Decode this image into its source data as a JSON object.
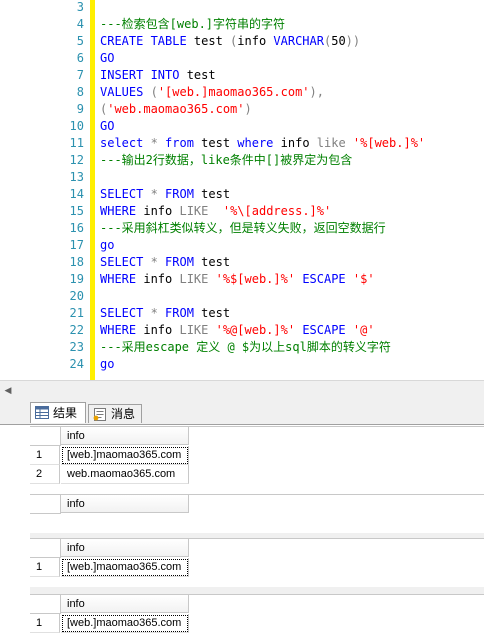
{
  "editor": {
    "lines": [
      {
        "n": "3",
        "segs": []
      },
      {
        "n": "4",
        "segs": [
          {
            "c": "cm",
            "t": "---检索包含[web.]字符串的字符"
          }
        ]
      },
      {
        "n": "5",
        "segs": [
          {
            "c": "kw",
            "t": "CREATE TABLE "
          },
          {
            "c": "tx",
            "t": "test "
          },
          {
            "c": "gy",
            "t": "("
          },
          {
            "c": "tx",
            "t": "info "
          },
          {
            "c": "kw",
            "t": "VARCHAR"
          },
          {
            "c": "gy",
            "t": "("
          },
          {
            "c": "tx",
            "t": "50"
          },
          {
            "c": "gy",
            "t": "))"
          }
        ]
      },
      {
        "n": "6",
        "segs": [
          {
            "c": "kw",
            "t": "GO"
          }
        ]
      },
      {
        "n": "7",
        "segs": [
          {
            "c": "kw",
            "t": "INSERT INTO "
          },
          {
            "c": "tx",
            "t": "test"
          }
        ]
      },
      {
        "n": "8",
        "segs": [
          {
            "c": "kw",
            "t": "VALUES "
          },
          {
            "c": "gy",
            "t": "("
          },
          {
            "c": "st",
            "t": "'[web.]maomao365.com'"
          },
          {
            "c": "gy",
            "t": "),"
          }
        ]
      },
      {
        "n": "9",
        "segs": [
          {
            "c": "gy",
            "t": "("
          },
          {
            "c": "st",
            "t": "'web.maomao365.com'"
          },
          {
            "c": "gy",
            "t": ")"
          }
        ]
      },
      {
        "n": "10",
        "segs": [
          {
            "c": "kw",
            "t": "GO"
          }
        ]
      },
      {
        "n": "11",
        "segs": [
          {
            "c": "kw",
            "t": "select "
          },
          {
            "c": "gy",
            "t": "* "
          },
          {
            "c": "kw",
            "t": "from "
          },
          {
            "c": "tx",
            "t": "test "
          },
          {
            "c": "kw",
            "t": "where "
          },
          {
            "c": "tx",
            "t": "info "
          },
          {
            "c": "gy",
            "t": "like "
          },
          {
            "c": "st",
            "t": "'%[web.]%'"
          }
        ]
      },
      {
        "n": "12",
        "segs": [
          {
            "c": "cm",
            "t": "---输出2行数据，like条件中[]被界定为包含"
          }
        ]
      },
      {
        "n": "13",
        "segs": []
      },
      {
        "n": "14",
        "segs": [
          {
            "c": "kw",
            "t": "SELECT "
          },
          {
            "c": "gy",
            "t": "* "
          },
          {
            "c": "kw",
            "t": "FROM "
          },
          {
            "c": "tx",
            "t": "test"
          }
        ]
      },
      {
        "n": "15",
        "segs": [
          {
            "c": "kw",
            "t": "WHERE "
          },
          {
            "c": "tx",
            "t": "info "
          },
          {
            "c": "gy",
            "t": "LIKE  "
          },
          {
            "c": "st",
            "t": "'%\\[address.]%'"
          }
        ]
      },
      {
        "n": "16",
        "segs": [
          {
            "c": "cm",
            "t": "---采用斜杠类似转义，但是转义失败，返回空数据行"
          }
        ]
      },
      {
        "n": "17",
        "segs": [
          {
            "c": "kw",
            "t": "go"
          }
        ]
      },
      {
        "n": "18",
        "segs": [
          {
            "c": "kw",
            "t": "SELECT "
          },
          {
            "c": "gy",
            "t": "* "
          },
          {
            "c": "kw",
            "t": "FROM "
          },
          {
            "c": "tx",
            "t": "test"
          }
        ]
      },
      {
        "n": "19",
        "segs": [
          {
            "c": "kw",
            "t": "WHERE "
          },
          {
            "c": "tx",
            "t": "info "
          },
          {
            "c": "gy",
            "t": "LIKE "
          },
          {
            "c": "st",
            "t": "'%$[web.]%' "
          },
          {
            "c": "kw",
            "t": "ESCAPE "
          },
          {
            "c": "st",
            "t": "'$'"
          }
        ]
      },
      {
        "n": "20",
        "segs": []
      },
      {
        "n": "21",
        "segs": [
          {
            "c": "kw",
            "t": "SELECT "
          },
          {
            "c": "gy",
            "t": "* "
          },
          {
            "c": "kw",
            "t": "FROM "
          },
          {
            "c": "tx",
            "t": "test"
          }
        ]
      },
      {
        "n": "22",
        "segs": [
          {
            "c": "kw",
            "t": "WHERE "
          },
          {
            "c": "tx",
            "t": "info "
          },
          {
            "c": "gy",
            "t": "LIKE "
          },
          {
            "c": "st",
            "t": "'%@[web.]%' "
          },
          {
            "c": "kw",
            "t": "ESCAPE "
          },
          {
            "c": "st",
            "t": "'@'"
          }
        ]
      },
      {
        "n": "23",
        "segs": [
          {
            "c": "cm",
            "t": "---采用escape 定义 @ $为以上sql脚本的转义字符"
          }
        ]
      },
      {
        "n": "24",
        "segs": [
          {
            "c": "kw",
            "t": "go"
          }
        ]
      }
    ]
  },
  "tabs": {
    "results_label": "结果",
    "messages_label": "消息"
  },
  "grids": [
    {
      "column": "info",
      "rows": [
        {
          "n": "1",
          "v": "[web.]maomao365.com",
          "sel": true
        },
        {
          "n": "2",
          "v": "web.maomao365.com",
          "sel": false
        }
      ]
    },
    {
      "column": "info",
      "rows": []
    },
    {
      "column": "info",
      "rows": [
        {
          "n": "1",
          "v": "[web.]maomao365.com",
          "sel": true
        }
      ]
    },
    {
      "column": "info",
      "rows": [
        {
          "n": "1",
          "v": "[web.]maomao365.com",
          "sel": true
        }
      ]
    }
  ],
  "colors": {
    "keyword": "#0000ff",
    "comment": "#008000",
    "string": "#ff0000",
    "operator": "#808080",
    "line_number": "#2b91af",
    "change_bar": "#ffef00"
  }
}
